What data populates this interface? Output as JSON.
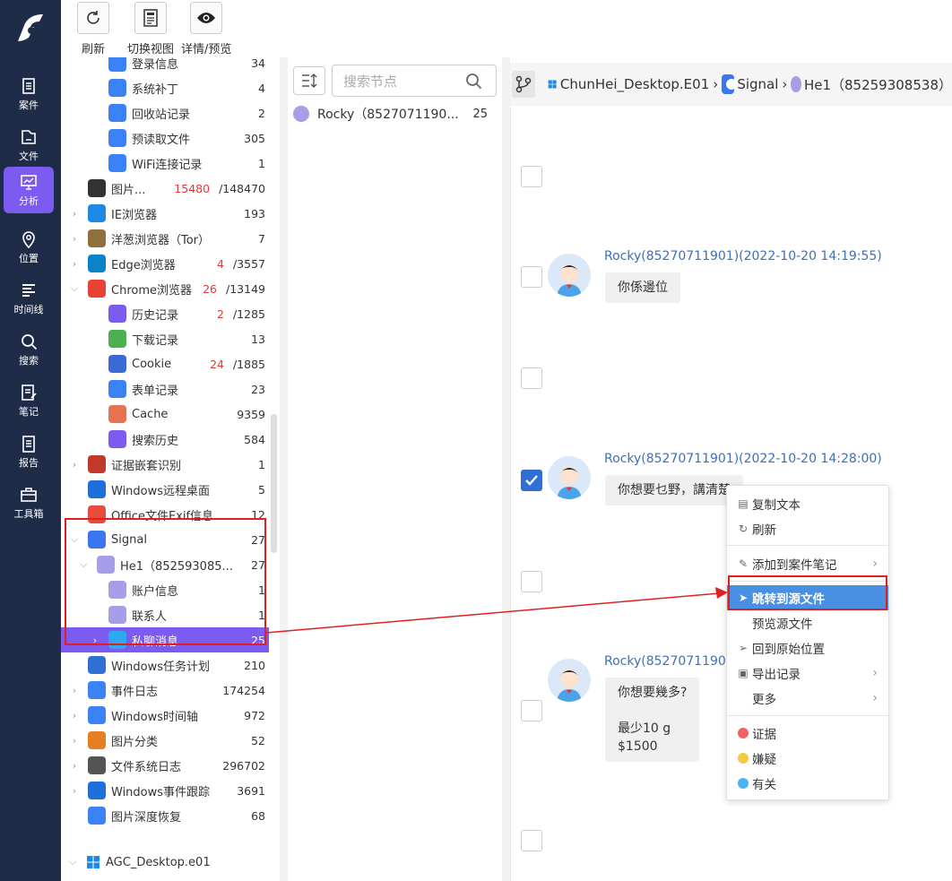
{
  "rail": {
    "items": [
      {
        "label": "案件",
        "icon": "case-icon"
      },
      {
        "label": "文件",
        "icon": "file-icon"
      },
      {
        "label": "分析",
        "icon": "analysis-icon",
        "active": true
      },
      {
        "label": "位置",
        "icon": "location-icon"
      },
      {
        "label": "时间线",
        "icon": "timeline-icon"
      },
      {
        "label": "搜索",
        "icon": "search-icon"
      },
      {
        "label": "笔记",
        "icon": "notes-icon"
      },
      {
        "label": "报告",
        "icon": "report-icon"
      },
      {
        "label": "工具箱",
        "icon": "toolbox-icon"
      }
    ]
  },
  "toolbar": {
    "refresh_label": "刷新",
    "switch_view_label": "切换视图",
    "details_label": "详情/预览"
  },
  "tree": {
    "rows": [
      {
        "label": "登录信息",
        "count": "34",
        "indent": 2,
        "icon": "login-icon",
        "color": "#3b82f6"
      },
      {
        "label": "系统补丁",
        "count": "4",
        "indent": 2,
        "icon": "patch-icon",
        "color": "#3b82f6"
      },
      {
        "label": "回收站记录",
        "count": "2",
        "indent": 2,
        "icon": "recycle-icon",
        "color": "#3b82f6"
      },
      {
        "label": "预读取文件",
        "count": "305",
        "indent": 2,
        "icon": "prefetch-icon",
        "color": "#3b82f6"
      },
      {
        "label": "WiFi连接记录",
        "count": "1",
        "indent": 2,
        "icon": "wifi-icon",
        "color": "#3b82f6"
      },
      {
        "label": "图片...",
        "count_red": "15480",
        "count": "/148470",
        "indent": 1,
        "icon": "image-icon",
        "color": "#333333"
      },
      {
        "label": "IE浏览器",
        "count": "193",
        "indent": 1,
        "arrow": ">",
        "icon": "ie-icon",
        "color": "#1e88e5"
      },
      {
        "label": "洋葱浏览器（Tor）",
        "count": "7",
        "indent": 1,
        "arrow": ">",
        "icon": "tor-icon",
        "color": "#8e6f3e"
      },
      {
        "label": "Edge浏览器",
        "count_red": "4",
        "count": "/3557",
        "indent": 1,
        "arrow": ">",
        "icon": "edge-icon",
        "color": "#0a84c6"
      },
      {
        "label": "Chrome浏览器",
        "count_red": "26",
        "count": "/13149",
        "indent": 1,
        "arrow": "v",
        "icon": "chrome-icon",
        "color": "#e94235"
      },
      {
        "label": "历史记录",
        "count_red": "2",
        "count": "/1285",
        "indent": 2,
        "icon": "history-icon",
        "color": "#7c5cf0"
      },
      {
        "label": "下载记录",
        "count": "13",
        "indent": 2,
        "icon": "download-icon",
        "color": "#4caf50"
      },
      {
        "label": "Cookie",
        "count_red": "24",
        "count": "/1885",
        "indent": 2,
        "icon": "cookie-icon",
        "color": "#3b6ad6"
      },
      {
        "label": "表单记录",
        "count": "23",
        "indent": 2,
        "icon": "form-icon",
        "color": "#3b82f6"
      },
      {
        "label": "Cache",
        "count": "9359",
        "indent": 2,
        "icon": "cache-icon",
        "color": "#e57350"
      },
      {
        "label": "搜索历史",
        "count": "584",
        "indent": 2,
        "icon": "search-history-icon",
        "color": "#7c5cf0"
      },
      {
        "label": "证据嵌套识别",
        "count": "1",
        "indent": 1,
        "arrow": ">",
        "icon": "evidence-nest-icon",
        "color": "#c0392b"
      },
      {
        "label": "Windows远程桌面",
        "count": "5",
        "indent": 1,
        "icon": "remote-desktop-icon",
        "color": "#1e6fd9"
      },
      {
        "label": "Office文件Exif信息",
        "count": "12",
        "indent": 1,
        "icon": "office-icon",
        "color": "#e74c3c"
      },
      {
        "label": "Signal",
        "count": "27",
        "indent": 1,
        "arrow": "v",
        "icon": "signal-icon",
        "color": "#3a76f0"
      },
      {
        "label": "He1（852593085...",
        "count": "27",
        "indent": 2,
        "arrow": "v",
        "icon": "user-icon",
        "color": "#a79ee8"
      },
      {
        "label": "账户信息",
        "count": "1",
        "indent": 3,
        "icon": "user-icon",
        "color": "#a79ee8"
      },
      {
        "label": "联系人",
        "count": "1",
        "indent": 3,
        "icon": "user-icon",
        "color": "#a79ee8"
      },
      {
        "label": "私聊消息",
        "count": "25",
        "indent": 3,
        "arrow": ">",
        "icon": "chat-bubble-icon",
        "color": "#2ea8f0",
        "selected": true
      },
      {
        "label": "Windows任务计划",
        "count": "210",
        "indent": 1,
        "icon": "clock-icon",
        "color": "#2f6fd6"
      },
      {
        "label": "事件日志",
        "count": "174254",
        "indent": 1,
        "arrow": ">",
        "icon": "event-log-icon",
        "color": "#3b82f6"
      },
      {
        "label": "Windows时间轴",
        "count": "972",
        "indent": 1,
        "arrow": ">",
        "icon": "timeline-icon",
        "color": "#3b82f6"
      },
      {
        "label": "图片分类",
        "count": "52",
        "indent": 1,
        "arrow": ">",
        "icon": "image-category-icon",
        "color": "#e67e22"
      },
      {
        "label": "文件系统日志",
        "count": "296702",
        "indent": 1,
        "arrow": ">",
        "icon": "fs-log-icon",
        "color": "#555555"
      },
      {
        "label": "Windows事件跟踪",
        "count": "3691",
        "indent": 1,
        "arrow": ">",
        "icon": "event-trace-icon",
        "color": "#1e6fd9"
      },
      {
        "label": "图片深度恢复",
        "count": "68",
        "indent": 1,
        "icon": "image-recovery-icon",
        "color": "#3b82f6"
      }
    ],
    "root2": {
      "label": "AGC_Desktop.e01",
      "arrow": "v",
      "icon": "windows-icon"
    }
  },
  "mid": {
    "search_placeholder": "搜索节点",
    "contact_name": "Rocky（8527071190...",
    "contact_count": "25"
  },
  "breadcrumb": {
    "items": [
      "ChunHei_Desktop.E01",
      "Signal",
      "He1（85259308538）"
    ],
    "separator": "›"
  },
  "chat": {
    "messages": [
      {
        "header": "Rocky(85270711901)(2022-10-20 14:19:55)",
        "text": "你係邊位",
        "checked": false
      },
      {
        "header": "Rocky(85270711901)(2022-10-20 14:28:00)",
        "text": "你想要乜野，講清楚",
        "checked": true
      },
      {
        "header": "Rocky(85270711901)",
        "text": "你想要幾多?\n\n最少10 g\n$1500",
        "checked": false
      }
    ]
  },
  "menu": {
    "copy_text": "复制文本",
    "refresh": "刷新",
    "add_note": "添加到案件笔记",
    "jump_source": "跳转到源文件",
    "preview_source": "预览源文件",
    "back_original": "回到原始位置",
    "export_record": "导出记录",
    "more": "更多",
    "tags": [
      {
        "label": "证据",
        "color": "#f0625f"
      },
      {
        "label": "嫌疑",
        "color": "#f5c842"
      },
      {
        "label": "有关",
        "color": "#4ab3f4"
      }
    ]
  },
  "colors": {
    "rail_bg": "#1f2c48",
    "accent": "#7c5cf0",
    "menu_highlight": "#4a90e2",
    "annotation_red": "#e02020"
  }
}
